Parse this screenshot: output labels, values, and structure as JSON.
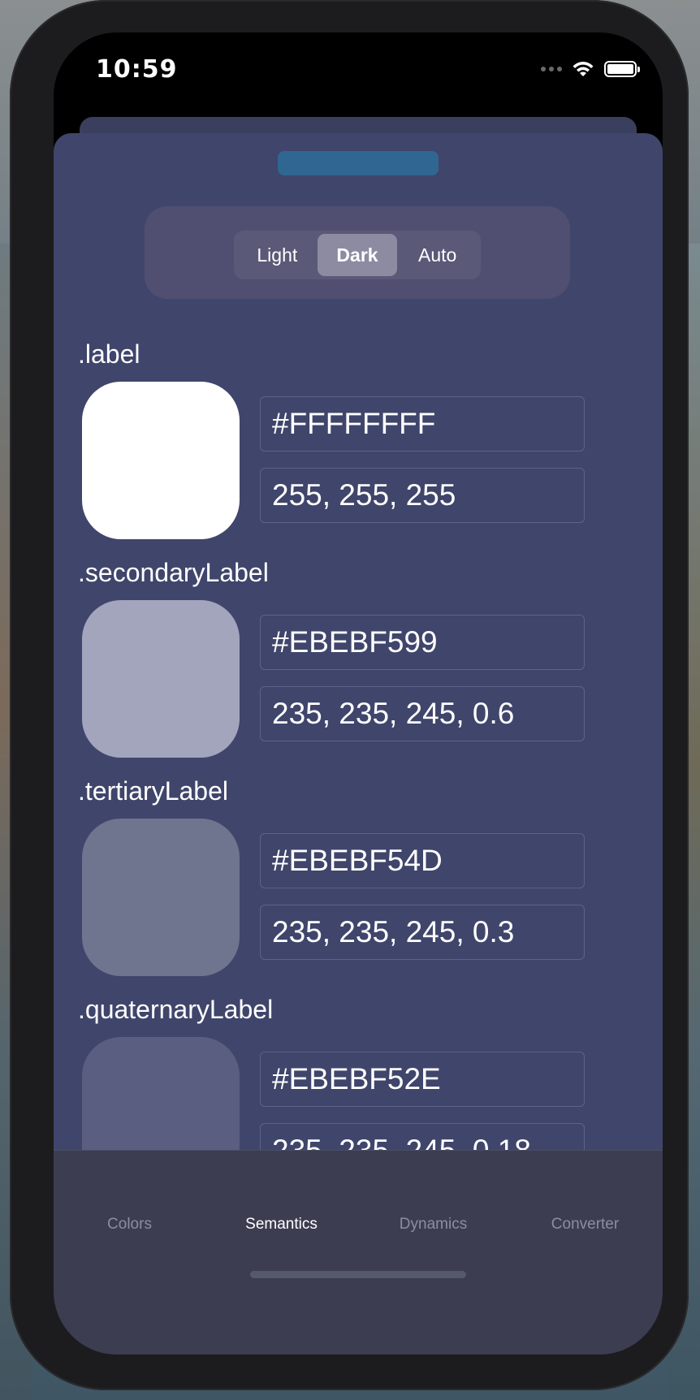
{
  "status_bar": {
    "time": "10:59"
  },
  "appearance": {
    "options": [
      "Light",
      "Dark",
      "Auto"
    ],
    "selected": "Dark"
  },
  "colors": [
    {
      "name": ".label",
      "hex": "#FFFFFFFF",
      "rgb": "255, 255, 255",
      "swatch": "#ffffff"
    },
    {
      "name": ".secondaryLabel",
      "hex": "#EBEBF599",
      "rgb": "235, 235, 245, 0.6",
      "swatch": "#a3a5bd"
    },
    {
      "name": ".tertiaryLabel",
      "hex": "#EBEBF54D",
      "rgb": "235, 235, 245, 0.3",
      "swatch": "#6f748f"
    },
    {
      "name": ".quaternaryLabel",
      "hex": "#EBEBF52E",
      "rgb": "235, 235, 245, 0.18",
      "swatch": "#5a5e80"
    }
  ],
  "tabs": [
    {
      "label": "Colors",
      "active": false
    },
    {
      "label": "Semantics",
      "active": true
    },
    {
      "label": "Dynamics",
      "active": false
    },
    {
      "label": "Converter",
      "active": false
    }
  ],
  "theme": {
    "sheet_background": "#40456b",
    "accent_handle": "#2f6792",
    "tab_inactive": "#8c8da0",
    "tab_active": "#ffffff"
  }
}
